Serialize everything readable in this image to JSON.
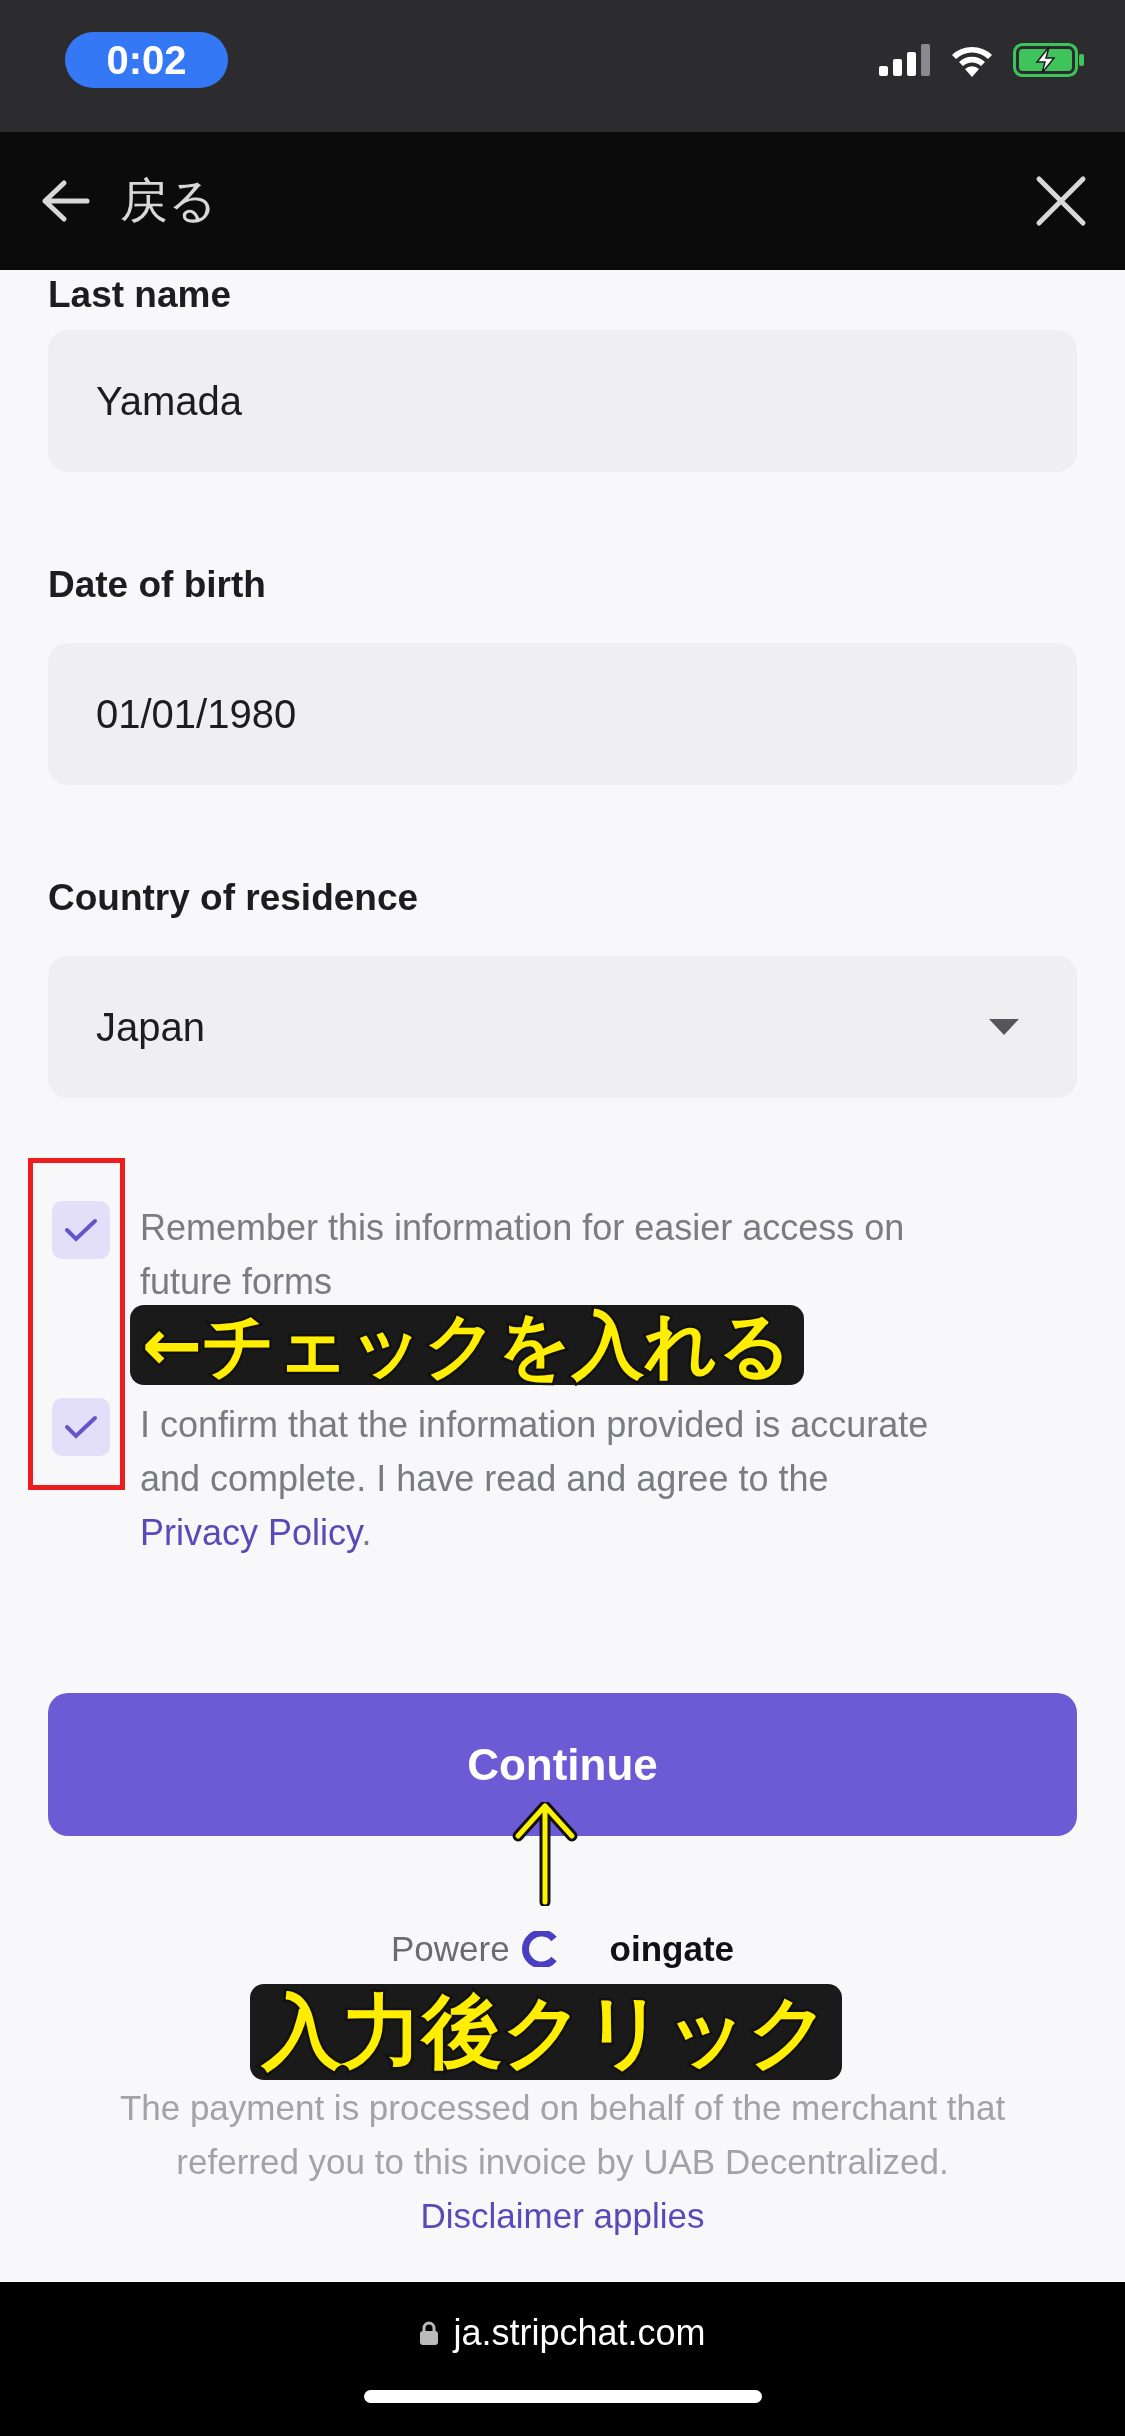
{
  "status_bar": {
    "time": "0:02"
  },
  "nav": {
    "back_label": "戻る"
  },
  "form": {
    "fields": [
      {
        "label": "Last name",
        "value": "Yamada",
        "kind": "text"
      },
      {
        "label": "Date of birth",
        "value": "01/01/1980",
        "kind": "text"
      },
      {
        "label": "Country of residence",
        "value": "Japan",
        "kind": "select"
      }
    ],
    "checkboxes": [
      {
        "text": "Remember this information for easier access on future forms",
        "checked": true
      },
      {
        "text": "I confirm that the information provided is accurate and complete. I have read and agree to the",
        "link": "Privacy Policy",
        "suffix": ".",
        "checked": true
      }
    ],
    "button": "Continue"
  },
  "footer": {
    "powered_prefix": "Powere",
    "powered_brand": "oingate",
    "disclaimer": "The payment is processed on behalf of the merchant that referred you to this invoice by UAB Decentralized.",
    "disclaimer_link": "Disclaimer applies"
  },
  "browser": {
    "url": "ja.stripchat.com"
  },
  "annotations": [
    {
      "kind": "box"
    },
    {
      "kind": "text",
      "text": "←チェックを入れる"
    },
    {
      "kind": "arrow"
    },
    {
      "kind": "text",
      "text": "入力後クリック"
    }
  ]
}
